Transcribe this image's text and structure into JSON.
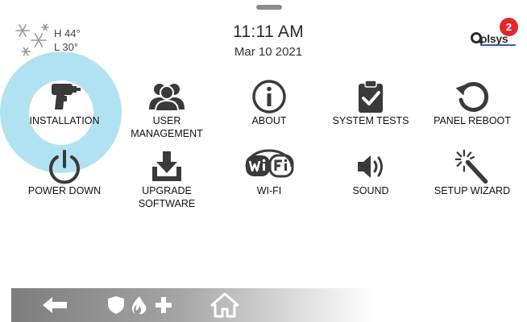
{
  "weather": {
    "high": "H 44°",
    "low": "L 30°",
    "icon": "snowflake-icon"
  },
  "header": {
    "time": "11:11 AM",
    "date": "Mar 10 2021",
    "brand": "olsys",
    "notification_count": "2"
  },
  "menu": {
    "row1": [
      {
        "label": "INSTALLATION",
        "icon": "drill-icon"
      },
      {
        "label": "USER MANAGEMENT",
        "icon": "users-icon"
      },
      {
        "label": "ABOUT",
        "icon": "info-icon"
      },
      {
        "label": "SYSTEM TESTS",
        "icon": "clipboard-check-icon"
      },
      {
        "label": "PANEL REBOOT",
        "icon": "reboot-icon"
      }
    ],
    "row2": [
      {
        "label": "POWER DOWN",
        "icon": "power-icon"
      },
      {
        "label_line1": "UPGRADE",
        "label_line2": "SOFTWARE",
        "icon": "download-icon"
      },
      {
        "label": "WI-FI",
        "icon": "wifi-logo-icon"
      },
      {
        "label": "SOUND",
        "icon": "speaker-icon"
      },
      {
        "label": "SETUP WIZARD",
        "icon": "magic-wand-icon"
      }
    ]
  },
  "navbar": {
    "icons": [
      "back-arrow-icon",
      "shield-icon",
      "fire-icon",
      "medical-plus-icon",
      "home-icon"
    ]
  },
  "colors": {
    "badge": "#e4262b",
    "ripple": "#a9dff0",
    "icon": "#3a3a3a"
  }
}
